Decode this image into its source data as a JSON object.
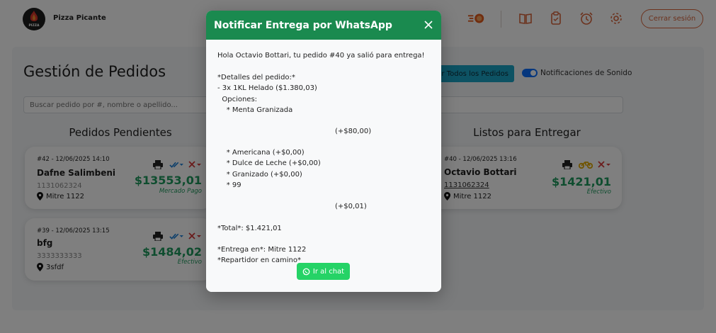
{
  "app": {
    "brand": "Pizza Picante",
    "logo_text": "PIZZA"
  },
  "header": {
    "icons": [
      "delivery-scooter-icon",
      "book-icon",
      "clipboard-icon",
      "alarm-clock-icon",
      "gear-icon"
    ],
    "logout_label": "Cerrar sesión",
    "accent_color": "#d8643b"
  },
  "main": {
    "title": "Gestión de Pedidos",
    "view_all_label": "er Todos los Pedidos",
    "sound_toggle_label": "Notificaciones de Sonido",
    "sound_toggle_on": true,
    "search_placeholder": "Buscar pedido por #, nombre o apellido...",
    "pending_title": "Pedidos Pendientes",
    "ready_title": "Listos para Entregar"
  },
  "pending_orders": [
    {
      "header": "#42 - 12/06/2025 14:10",
      "name": "Dafne Salimbeni",
      "phone": "1131062324",
      "address": "Mitre 1122",
      "amount": "$13553,01",
      "method": "Mercado Pago"
    },
    {
      "header": "#39 - 12/06/2025 13:15",
      "name": "bfg",
      "phone": "3333333333",
      "address": "3sfdf",
      "amount": "$1484,02",
      "method": "Efectivo"
    }
  ],
  "ready_orders": [
    {
      "header": "#40 - 12/06/2025 13:16",
      "name": "Octavio Bottari",
      "phone": "1131062324",
      "address": "Mitre 1122",
      "amount": "$1421,01",
      "method": "Efectivo"
    }
  ],
  "modal": {
    "title": "Notificar Entrega por WhatsApp",
    "lines": [
      "Hola Octavio Bottari, tu pedido #40 ya salió para entrega!",
      "*Detalles del pedido:*",
      "- 3x 1KL Helado ($1.380,03)",
      "  Opciones:",
      "    * Menta Granizada",
      "(+$80,00)",
      "    * Americana (+$0,00)",
      "    * Dulce de Leche (+$0,00)",
      "    * Granizado (+$0,00)",
      "    * 99",
      "(+$0,01)",
      "*Total*: $1.421,01",
      "*Entrega en*: Mitre 1122",
      "*Repartidor en camino*"
    ],
    "chat_button_label": "Ir al chat",
    "header_color": "#1a8a4f",
    "button_color": "#25d366"
  }
}
